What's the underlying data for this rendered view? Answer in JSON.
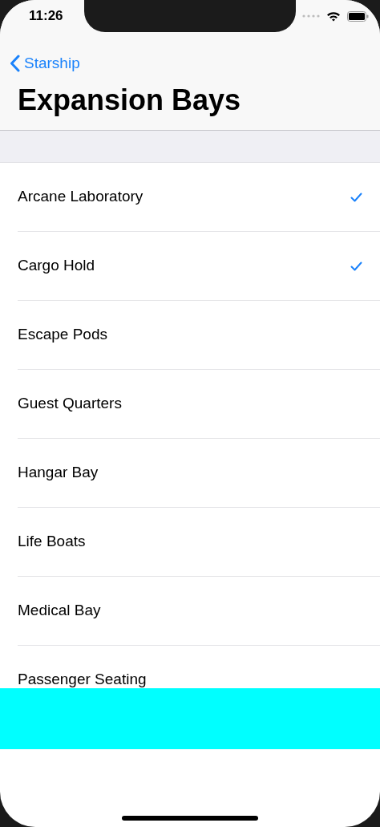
{
  "status_bar": {
    "time": "11:26"
  },
  "nav": {
    "back_label": "Starship",
    "title": "Expansion Bays"
  },
  "items": [
    {
      "label": "Arcane Laboratory",
      "checked": true
    },
    {
      "label": "Cargo Hold",
      "checked": true
    },
    {
      "label": "Escape Pods",
      "checked": false
    },
    {
      "label": "Guest Quarters",
      "checked": false
    },
    {
      "label": "Hangar Bay",
      "checked": false
    },
    {
      "label": "Life Boats",
      "checked": false
    },
    {
      "label": "Medical Bay",
      "checked": false
    },
    {
      "label": "Passenger Seating",
      "checked": false
    }
  ]
}
